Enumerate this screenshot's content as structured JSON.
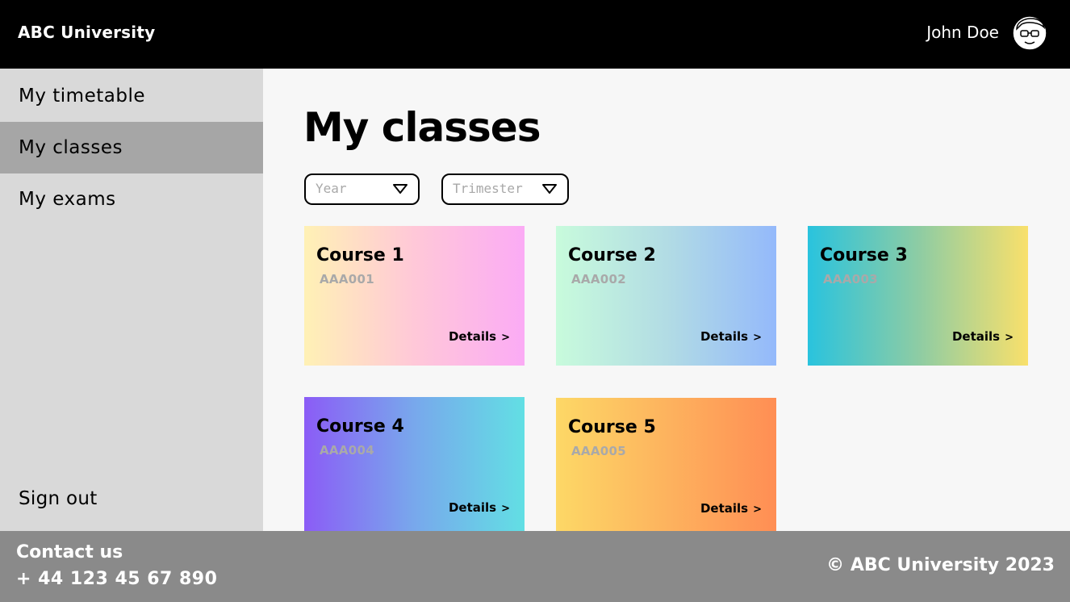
{
  "header": {
    "brand": "ABC University",
    "user_name": "John Doe"
  },
  "sidebar": {
    "items": [
      {
        "label": "My timetable",
        "active": false
      },
      {
        "label": "My classes",
        "active": true
      },
      {
        "label": "My exams",
        "active": false
      }
    ],
    "sign_out": "Sign out"
  },
  "main": {
    "title": "My classes",
    "filters": [
      {
        "placeholder": "Year"
      },
      {
        "placeholder": "Trimester"
      }
    ],
    "courses": [
      {
        "title": "Course 1",
        "code": "AAA001",
        "link": "Details",
        "gradient": [
          "#fff1b5",
          "#ffc8d8",
          "#fbabf5"
        ]
      },
      {
        "title": "Course 2",
        "code": "AAA002",
        "link": "Details",
        "gradient": [
          "#c8fbdc",
          "#b2dce4",
          "#94b9fb"
        ]
      },
      {
        "title": "Course 3",
        "code": "AAA003",
        "link": "Details",
        "gradient": [
          "#29c3de",
          "#8dcca4",
          "#f9e06b"
        ]
      },
      {
        "title": "Course 4",
        "code": "AAA004",
        "link": "Details",
        "gradient": [
          "#8b5cf6",
          "#78a8ec",
          "#62dfe4"
        ]
      },
      {
        "title": "Course 5",
        "code": "AAA005",
        "link": "Details",
        "gradient": [
          "#fdd866",
          "#fdb35e",
          "#ff8e54"
        ]
      }
    ],
    "link_chevron": ">"
  },
  "footer": {
    "contact_label": "Contact us",
    "phone": "+ 44 123 45 67 890",
    "copyright": "© ABC University 2023"
  },
  "colors": {
    "topbar": "#000000",
    "sidebar": "#d9d9d9",
    "sidebar_active": "#a6a6a6",
    "footer": "#8a8a8a",
    "main_bg": "#f7f7f7"
  }
}
